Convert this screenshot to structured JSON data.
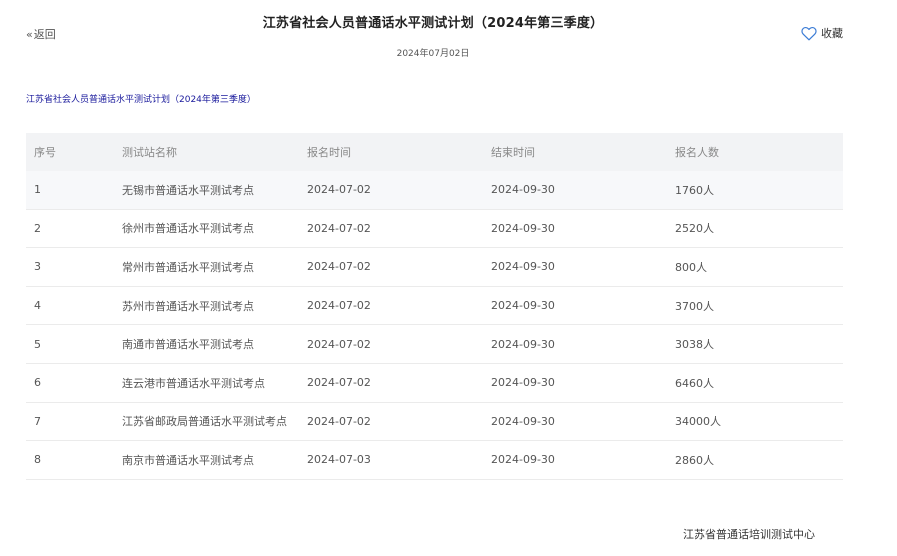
{
  "header": {
    "back_label": "返回",
    "title": "江苏省社会人员普通话水平测试计划（2024年第三季度）",
    "date": "2024年07月02日",
    "favorite_label": "收藏"
  },
  "content": {
    "doc_link": "江苏省社会人员普通话水平测试计划（2024年第三季度）"
  },
  "table": {
    "headers": [
      "序号",
      "测试站名称",
      "报名时间",
      "结束时间",
      "报名人数"
    ],
    "rows": [
      [
        "1",
        "无锡市普通话水平测试考点",
        "2024-07-02",
        "2024-09-30",
        "1760人"
      ],
      [
        "2",
        "徐州市普通话水平测试考点",
        "2024-07-02",
        "2024-09-30",
        "2520人"
      ],
      [
        "3",
        "常州市普通话水平测试考点",
        "2024-07-02",
        "2024-09-30",
        "800人"
      ],
      [
        "4",
        "苏州市普通话水平测试考点",
        "2024-07-02",
        "2024-09-30",
        "3700人"
      ],
      [
        "5",
        "南通市普通话水平测试考点",
        "2024-07-02",
        "2024-09-30",
        "3038人"
      ],
      [
        "6",
        "连云港市普通话水平测试考点",
        "2024-07-02",
        "2024-09-30",
        "6460人"
      ],
      [
        "7",
        "江苏省邮政局普通话水平测试考点",
        "2024-07-02",
        "2024-09-30",
        "34000人"
      ],
      [
        "8",
        "南京市普通话水平测试考点",
        "2024-07-03",
        "2024-09-30",
        "2860人"
      ]
    ]
  },
  "footer": {
    "organization": "江苏省普通话培训测试中心"
  },
  "icons": {
    "back": "double-chevron-left-icon",
    "favorite": "heart-icon"
  },
  "colors": {
    "favorite_icon": "#3a7bd5",
    "doc_link": "#1a1a9c",
    "table_header_bg": "#f2f3f5"
  }
}
